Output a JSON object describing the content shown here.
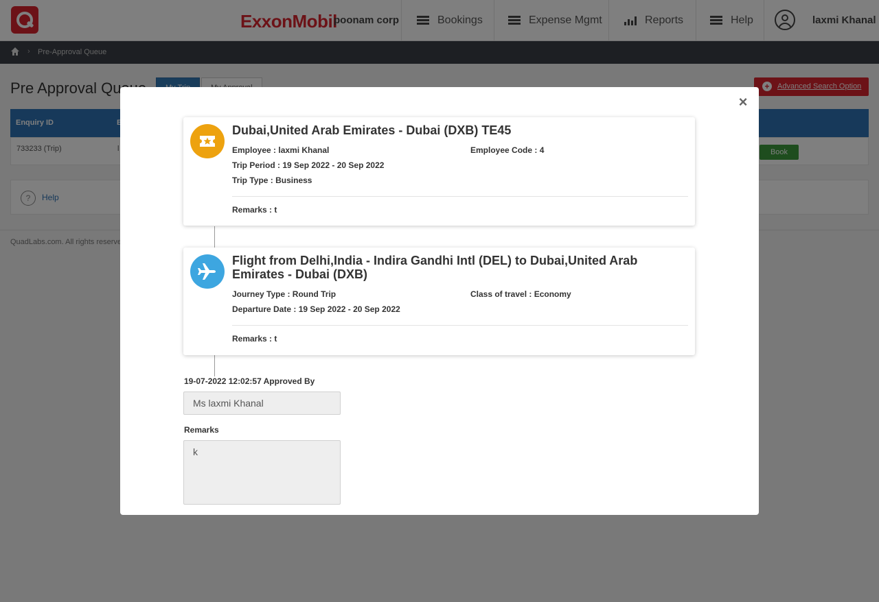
{
  "header": {
    "brand": "ExxonMobil",
    "company": "poonam corp",
    "nav": [
      {
        "label": "Bookings"
      },
      {
        "label": "Expense Mgmt"
      },
      {
        "label": "Reports"
      },
      {
        "label": "Help"
      }
    ],
    "user_name": "laxmi Khanal"
  },
  "breadcrumb": {
    "current": "Pre-Approval Queue"
  },
  "page": {
    "title": "Pre Approval Queue",
    "tabs": [
      {
        "label": "My Trip"
      },
      {
        "label": "My Approval"
      }
    ],
    "advanced_search": "Advanced Search Option",
    "table": {
      "headers": [
        "Enquiry ID",
        "E"
      ],
      "row": {
        "enquiry_id": "733233 (Trip)",
        "col2": "l",
        "action": "Book"
      }
    },
    "help": "Help",
    "footer": "QuadLabs.com. All rights reserved"
  },
  "modal": {
    "close_label": "×",
    "trip_card": {
      "icon": "ticket-star-icon",
      "title": "Dubai,United Arab Emirates - Dubai (DXB) TE45",
      "employee": "Employee : laxmi Khanal",
      "employee_code": "Employee Code : 4",
      "trip_period": "Trip Period : 19 Sep 2022 - 20 Sep 2022",
      "trip_type": "Trip Type : Business",
      "remarks": "Remarks :  t"
    },
    "flight_card": {
      "icon": "airplane-icon",
      "title": "Flight from Delhi,India - Indira Gandhi Intl (DEL) to Dubai,United Arab Emirates - Dubai (DXB)",
      "journey_type": "Journey Type : Round Trip",
      "class_of_travel": "Class of travel : Economy",
      "departure_date": "Departure Date : 19 Sep 2022 - 20 Sep 2022",
      "remarks": "Remarks : t"
    },
    "approval": {
      "approved_by_label": "19-07-2022 12:02:57 Approved By",
      "approver": "Ms laxmi Khanal",
      "remarks_label": "Remarks",
      "remarks_value": "k"
    }
  },
  "colors": {
    "brand_red": "#d9242f",
    "trip_icon_bg": "#eda20f",
    "flight_icon_bg": "#3da6e0",
    "table_header": "#2f72b4"
  }
}
